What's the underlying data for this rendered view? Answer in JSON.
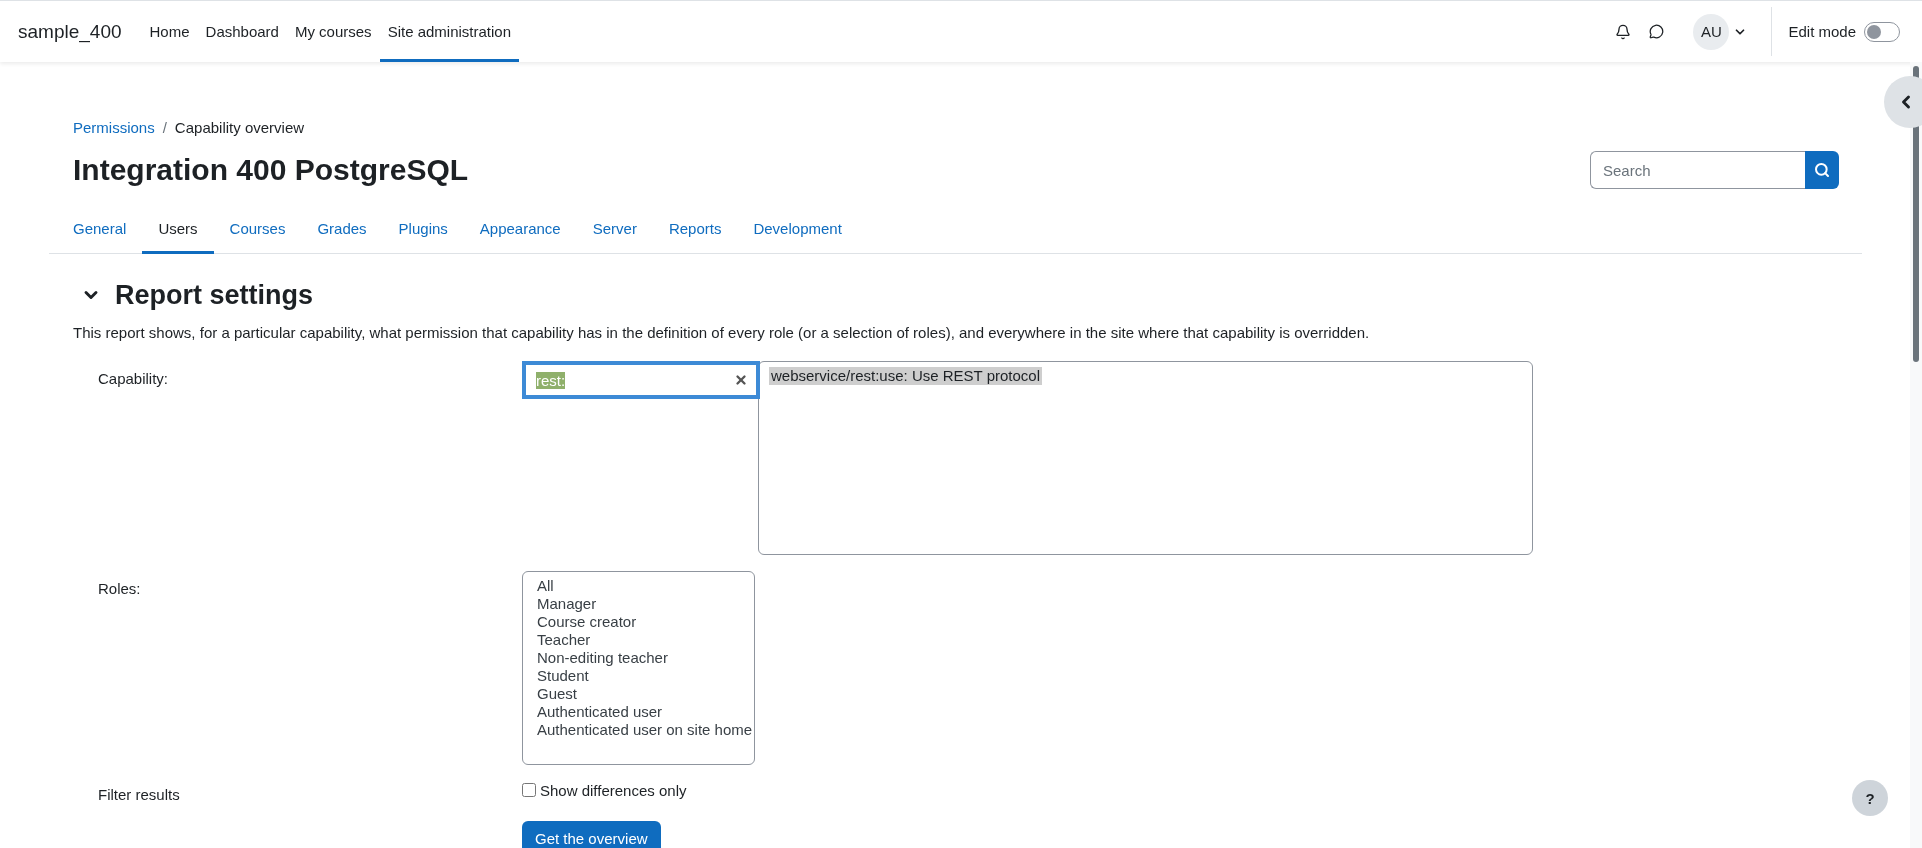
{
  "site_name": "sample_400",
  "nav": [
    {
      "label": "Home",
      "selected": false
    },
    {
      "label": "Dashboard",
      "selected": false
    },
    {
      "label": "My courses",
      "selected": false
    },
    {
      "label": "Site administration",
      "selected": true
    }
  ],
  "user_initials": "AU",
  "edit_mode": {
    "label": "Edit mode",
    "on": false
  },
  "breadcrumb": [
    {
      "label": "Permissions",
      "kind": "link"
    },
    {
      "label": "Capability overview",
      "kind": "current"
    }
  ],
  "breadcrumb_separator": "/",
  "page_title": "Integration 400 PostgreSQL",
  "search": {
    "placeholder": "Search"
  },
  "tabs": [
    {
      "label": "General",
      "selected": false
    },
    {
      "label": "Users",
      "selected": true
    },
    {
      "label": "Courses",
      "selected": false
    },
    {
      "label": "Grades",
      "selected": false
    },
    {
      "label": "Plugins",
      "selected": false
    },
    {
      "label": "Appearance",
      "selected": false
    },
    {
      "label": "Server",
      "selected": false
    },
    {
      "label": "Reports",
      "selected": false
    },
    {
      "label": "Development",
      "selected": false
    }
  ],
  "section": {
    "title": "Report settings",
    "expanded": true,
    "description": "This report shows, for a particular capability, what permission that capability has in the definition of every role (or a selection of roles), and everywhere in the site where that capability is overridden."
  },
  "capability": {
    "label": "Capability:",
    "filter_value": "rest:",
    "options": [
      {
        "label": "webservice/rest:use: Use REST protocol",
        "selected": true
      }
    ]
  },
  "roles": {
    "label": "Roles:",
    "options": [
      {
        "label": "All",
        "selected": false
      },
      {
        "label": "Manager",
        "selected": false
      },
      {
        "label": "Course creator",
        "selected": false
      },
      {
        "label": "Teacher",
        "selected": false
      },
      {
        "label": "Non-editing teacher",
        "selected": false
      },
      {
        "label": "Student",
        "selected": false
      },
      {
        "label": "Guest",
        "selected": false
      },
      {
        "label": "Authenticated user",
        "selected": false
      },
      {
        "label": "Authenticated user on site home",
        "selected": false
      }
    ]
  },
  "filter": {
    "label": "Filter results",
    "checkbox_label": "Show differences only",
    "checked": false
  },
  "submit": "Get the overview",
  "help_button": "?"
}
